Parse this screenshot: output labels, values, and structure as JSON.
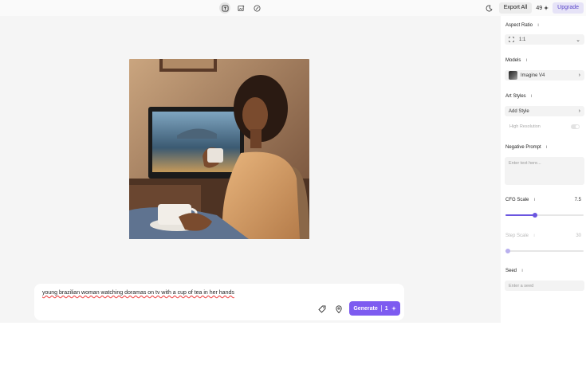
{
  "topbar": {
    "icons": [
      "text-icon",
      "image-edit-icon",
      "sketch-icon"
    ],
    "export_label": "Export All",
    "credits": "49",
    "upgrade_label": "Upgrade"
  },
  "prompt": {
    "text": "young brazilian woman watching doramas on tv with a cup of tea in her hands",
    "generate_label": "Generate",
    "generate_cost": "1"
  },
  "panel": {
    "aspect_ratio": {
      "label": "Aspect Ratio",
      "value": "1:1"
    },
    "models": {
      "label": "Models",
      "value": "Imagine V4"
    },
    "art_styles": {
      "label": "Art Styles",
      "value": "Add Style",
      "high_res_label": "High Resolution"
    },
    "negative_prompt": {
      "label": "Negative Prompt",
      "placeholder": "Enter text here..."
    },
    "cfg_scale": {
      "label": "CFG Scale",
      "value": "7.5",
      "fraction": 0.38
    },
    "step_scale": {
      "label": "Step Scale",
      "value": "30",
      "fraction": 0.0
    },
    "seed": {
      "label": "Seed",
      "placeholder": "Enter a seed"
    }
  },
  "colors": {
    "accent": "#7d5bf0",
    "panel_bg": "#ffffff",
    "canvas_bg": "#f5f5f5"
  }
}
